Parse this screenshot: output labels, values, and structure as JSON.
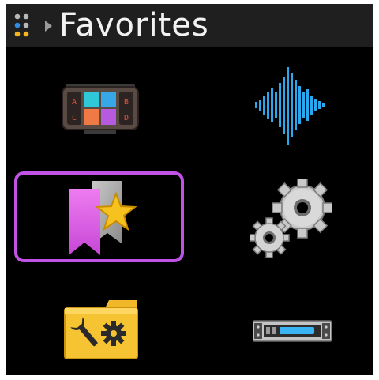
{
  "header": {
    "title": "Favorites",
    "menu_icon": "dots-grid-icon",
    "breadcrumb_icon": "chevron-right-icon"
  },
  "tiles": [
    {
      "icon": "pad-controller-icon",
      "pad_labels": [
        "A",
        "B",
        "C",
        "D"
      ]
    },
    {
      "icon": "waveform-icon"
    },
    {
      "icon": "bookmark-star-icon",
      "selected": true
    },
    {
      "icon": "gears-icon"
    },
    {
      "icon": "folder-tools-icon"
    },
    {
      "icon": "rack-device-icon"
    }
  ],
  "colors": {
    "header_bg": "#1f1f1f",
    "selection": "#c053e6",
    "waveform": "#2aa8ee",
    "bookmark": "#e864e8",
    "folder": "#f4c430"
  }
}
